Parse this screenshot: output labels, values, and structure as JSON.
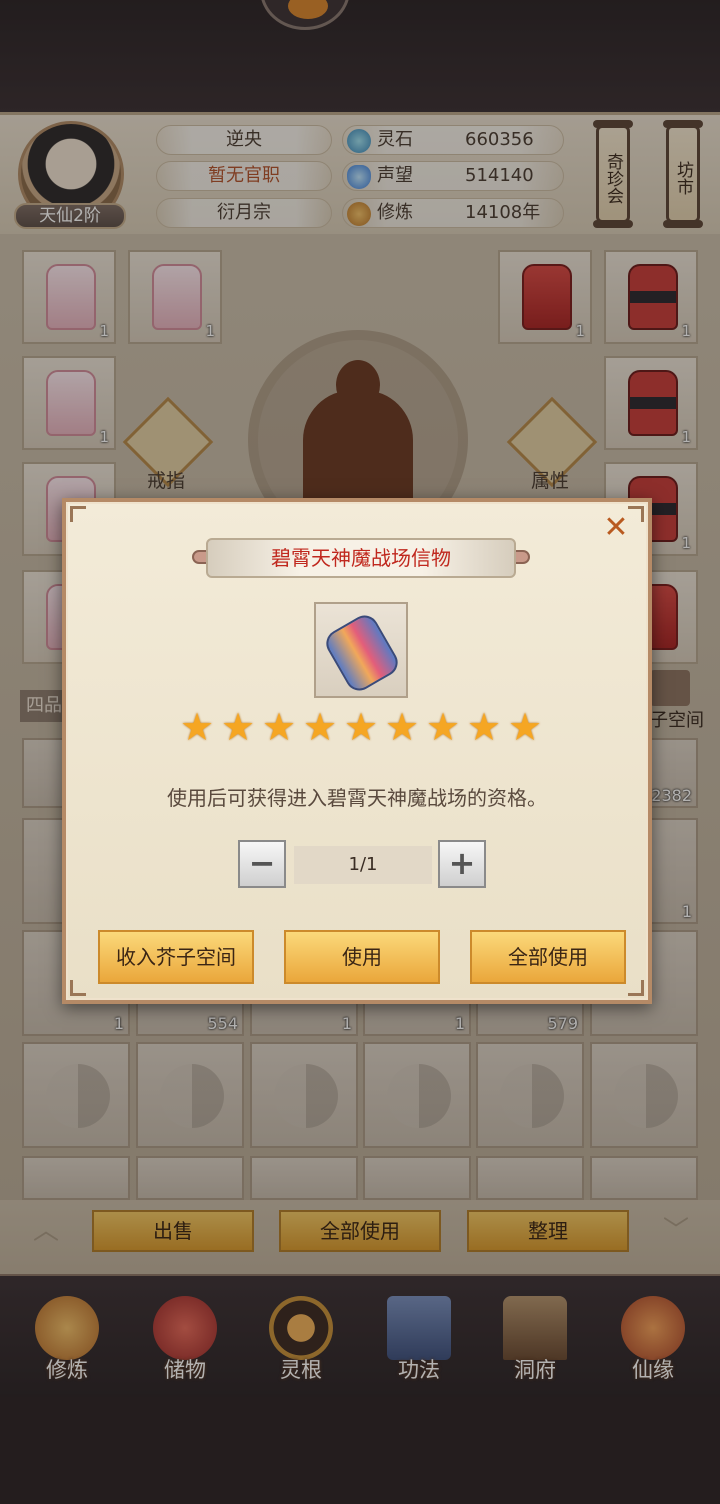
{
  "header": {
    "rank": "天仙2阶",
    "name": "逆央",
    "title": "暂无官职",
    "sect": "衍月宗",
    "stats": [
      {
        "icon": "spirit-stone-icon",
        "label": "灵石",
        "value": "660356"
      },
      {
        "icon": "reputation-icon",
        "label": "声望",
        "value": "514140"
      },
      {
        "icon": "cultivation-icon",
        "label": "修炼",
        "value": "14108年"
      }
    ],
    "scroll_buttons": [
      "奇珍会",
      "坊市"
    ]
  },
  "equipment": {
    "ring_label": "戒指",
    "attr_label": "属性",
    "left_slots": [
      {
        "count": "1"
      },
      {
        "count": "1"
      },
      {
        "count": "1"
      }
    ],
    "right_slots": [
      {
        "count": "1"
      },
      {
        "count": "1"
      },
      {
        "count": "1"
      },
      {
        "count": "1"
      }
    ]
  },
  "bag": {
    "tab_label": "四品",
    "space_label": "子空间",
    "partial_count": "2382",
    "row_counts": [
      "1",
      "554",
      "1",
      "1",
      "579",
      ""
    ]
  },
  "modal": {
    "title": "碧霄天神魔战场信物",
    "close": "✕",
    "stars": 9,
    "star_glyph": "★",
    "description": "使用后可获得进入碧霄天神魔战场的资格。",
    "minus": "−",
    "plus": "+",
    "quantity": "1/1",
    "buttons": [
      "收入芥子空间",
      "使用",
      "全部使用"
    ]
  },
  "action_bar": {
    "buttons": [
      "出售",
      "全部使用",
      "整理"
    ]
  },
  "nav": [
    {
      "label": "修炼",
      "icon": "cultivate-icon",
      "color": "#d89a3b"
    },
    {
      "label": "储物",
      "icon": "storage-bag-icon",
      "color": "#c94a3c"
    },
    {
      "label": "灵根",
      "icon": "spirit-root-icon",
      "color": "#8a4a2a"
    },
    {
      "label": "功法",
      "icon": "technique-book-icon",
      "color": "#5a6f9a"
    },
    {
      "label": "洞府",
      "icon": "cave-house-icon",
      "color": "#8a6a4a"
    },
    {
      "label": "仙缘",
      "icon": "gourd-icon",
      "color": "#c76a3a"
    }
  ],
  "colors": {
    "modal_title": "#c0281e",
    "button_gold": "#eaa73b",
    "star": "#f5a623"
  }
}
